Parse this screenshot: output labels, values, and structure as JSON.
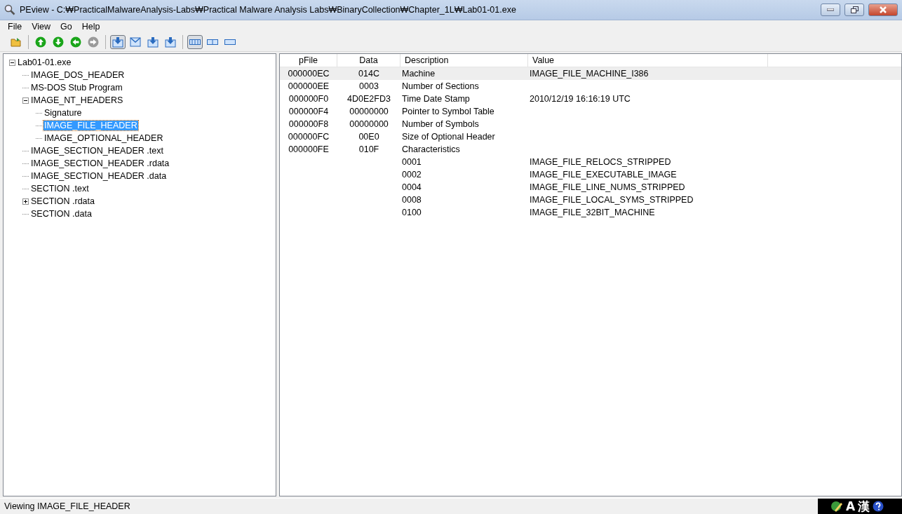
{
  "window": {
    "title": "PEview - C:₩PracticalMalwareAnalysis-Labs₩Practical Malware Analysis Labs₩BinaryCollection₩Chapter_1L₩Lab01-01.exe"
  },
  "menu": [
    "File",
    "View",
    "Go",
    "Help"
  ],
  "toolbar": [
    {
      "kind": "open",
      "selected": false
    },
    {
      "kind": "sep"
    },
    {
      "kind": "up",
      "selected": false,
      "disabled": false
    },
    {
      "kind": "down",
      "selected": false,
      "disabled": false
    },
    {
      "kind": "left",
      "selected": false,
      "disabled": false
    },
    {
      "kind": "right",
      "selected": false,
      "disabled": true
    },
    {
      "kind": "sep"
    },
    {
      "kind": "tray",
      "selected": true
    },
    {
      "kind": "mail",
      "selected": false
    },
    {
      "kind": "tray",
      "selected": false
    },
    {
      "kind": "tray",
      "selected": false
    },
    {
      "kind": "sep"
    },
    {
      "kind": "bars",
      "selected": true
    },
    {
      "kind": "split",
      "selected": false
    },
    {
      "kind": "bar",
      "selected": false
    }
  ],
  "tree": [
    {
      "label": "Lab01-01.exe",
      "selected": false,
      "expanded": true,
      "children": [
        {
          "label": "IMAGE_DOS_HEADER",
          "selected": false
        },
        {
          "label": "MS-DOS Stub Program",
          "selected": false
        },
        {
          "label": "IMAGE_NT_HEADERS",
          "selected": false,
          "expanded": true,
          "children": [
            {
              "label": "Signature",
              "selected": false
            },
            {
              "label": "IMAGE_FILE_HEADER",
              "selected": true
            },
            {
              "label": "IMAGE_OPTIONAL_HEADER",
              "selected": false
            }
          ]
        },
        {
          "label": "IMAGE_SECTION_HEADER .text",
          "selected": false
        },
        {
          "label": "IMAGE_SECTION_HEADER .rdata",
          "selected": false
        },
        {
          "label": "IMAGE_SECTION_HEADER .data",
          "selected": false
        },
        {
          "label": "SECTION .text",
          "selected": false
        },
        {
          "label": "SECTION .rdata",
          "selected": false,
          "expanded": false
        },
        {
          "label": "SECTION .data",
          "selected": false
        }
      ]
    }
  ],
  "table": {
    "columns": [
      "pFile",
      "Data",
      "Description",
      "Value"
    ],
    "rows": [
      {
        "selected": true,
        "cells": [
          "000000EC",
          "014C",
          "Machine",
          "IMAGE_FILE_MACHINE_I386"
        ]
      },
      {
        "selected": false,
        "cells": [
          "000000EE",
          "0003",
          "Number of Sections",
          ""
        ]
      },
      {
        "selected": false,
        "cells": [
          "000000F0",
          "4D0E2FD3",
          "Time Date Stamp",
          "2010/12/19  16:16:19 UTC"
        ]
      },
      {
        "selected": false,
        "cells": [
          "000000F4",
          "00000000",
          "Pointer to Symbol Table",
          ""
        ]
      },
      {
        "selected": false,
        "cells": [
          "000000F8",
          "00000000",
          "Number of Symbols",
          ""
        ]
      },
      {
        "selected": false,
        "cells": [
          "000000FC",
          "00E0",
          "Size of Optional Header",
          ""
        ]
      },
      {
        "selected": false,
        "cells": [
          "000000FE",
          "010F",
          "Characteristics",
          ""
        ]
      },
      {
        "selected": false,
        "cells": [
          "",
          "",
          "0001",
          "IMAGE_FILE_RELOCS_STRIPPED"
        ]
      },
      {
        "selected": false,
        "cells": [
          "",
          "",
          "0002",
          "IMAGE_FILE_EXECUTABLE_IMAGE"
        ]
      },
      {
        "selected": false,
        "cells": [
          "",
          "",
          "0004",
          "IMAGE_FILE_LINE_NUMS_STRIPPED"
        ]
      },
      {
        "selected": false,
        "cells": [
          "",
          "",
          "0008",
          "IMAGE_FILE_LOCAL_SYMS_STRIPPED"
        ]
      },
      {
        "selected": false,
        "cells": [
          "",
          "",
          "0100",
          "IMAGE_FILE_32BIT_MACHINE"
        ]
      }
    ]
  },
  "status_bar": {
    "text": "Viewing IMAGE_FILE_HEADER"
  },
  "ime_bar": {
    "mode": "A",
    "script": "漢"
  }
}
